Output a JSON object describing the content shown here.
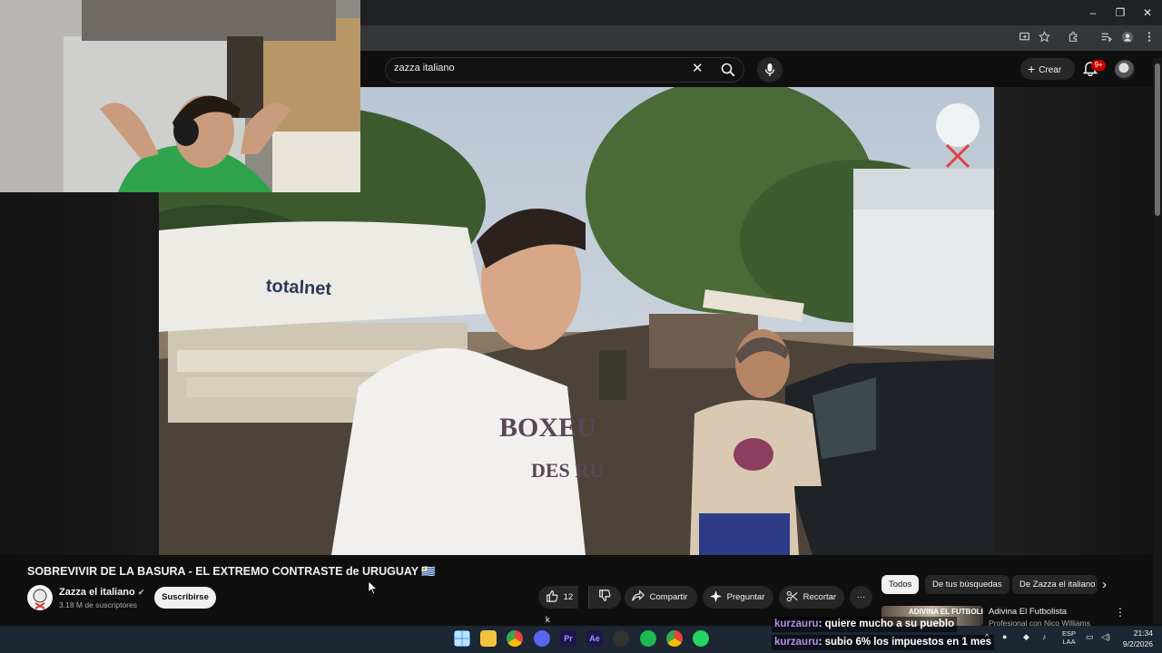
{
  "browser": {
    "window_controls": [
      "–",
      "❐",
      "✕"
    ],
    "toolbar_icons": [
      "cast-icon",
      "star-icon",
      "extensions-icon",
      "media-icon",
      "profile-icon",
      "menu-icon"
    ]
  },
  "youtube": {
    "search": {
      "value": "zazza italiano"
    },
    "create_label": "Crear",
    "notifications_badge": "9+"
  },
  "video": {
    "umbrella_brand": "totalnet",
    "shirt_text_1": "BOXEU",
    "shirt_text_2": "DES RU",
    "title": "SOBREVIVIR DE LA BASURA - EL EXTREMO CONTRASTE de URUGUAY 🇺🇾"
  },
  "channel": {
    "name": "Zazza el italiano",
    "subscribers": "3.18 M de suscriptores",
    "subscribe_label": "Suscribirse"
  },
  "actions": {
    "likes": "12 k",
    "share_label": "Compartir",
    "ask_label": "Preguntar",
    "clip_label": "Recortar",
    "more_label": "···"
  },
  "sidebar": {
    "chips": [
      "Todos",
      "De tus búsquedas",
      "De Zazza el italiano"
    ],
    "recommendation": {
      "thumb_text": "ADIVINA EL FUTBOLISTA",
      "title": "Adivina El Futbolista",
      "subtitle": "Profesional con Nico Williams"
    }
  },
  "chat": [
    {
      "user": "kurzauru",
      "message": ": quiere mucho a su pueblo"
    },
    {
      "user": "kurzauru",
      "message": ": subio 6% los impuestos en 1 mes"
    }
  ],
  "taskbar": {
    "language": "ESP",
    "language_sub": "LAA",
    "time": "21:34",
    "date": "9/2/2026"
  },
  "colors": {
    "accent_red": "#cc0000",
    "chip_bg": "#272727",
    "page_bg": "#0f0f0f"
  }
}
